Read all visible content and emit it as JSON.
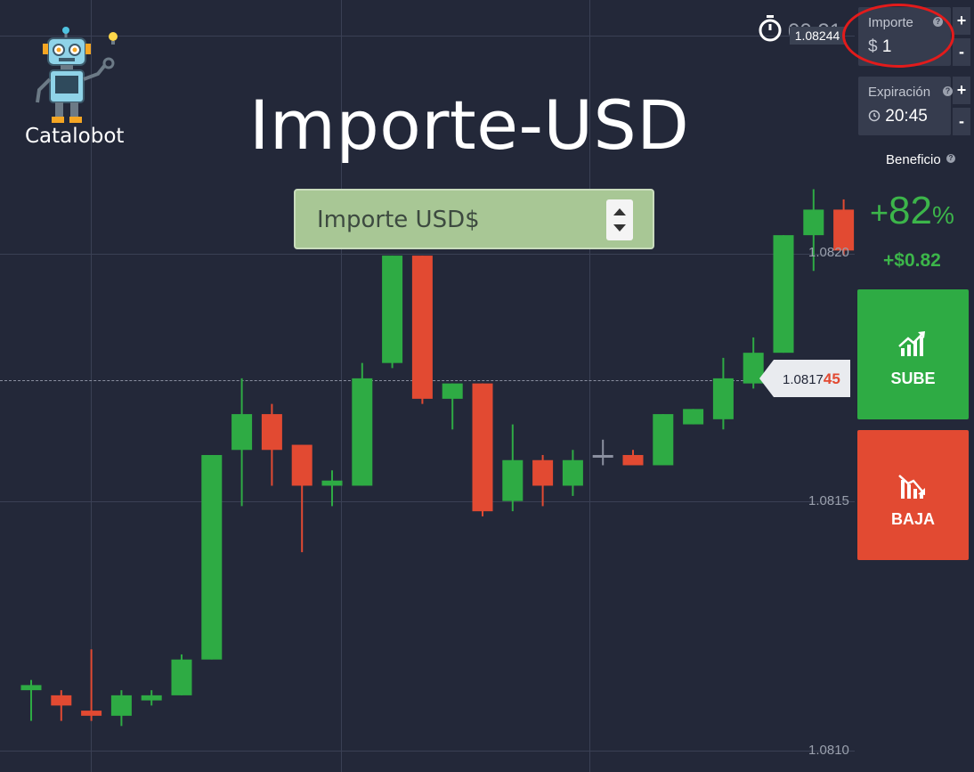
{
  "branding": {
    "logo_label": "Catalobot"
  },
  "overlay": {
    "title": "Importe-USD",
    "usd_field_label": "Importe USD$"
  },
  "header": {
    "timer": "00:21",
    "current_price": "1.08244"
  },
  "panel": {
    "importe": {
      "label": "Importe",
      "currency": "$",
      "value": "1",
      "plus": "+",
      "minus": "-"
    },
    "expiracion": {
      "label": "Expiración",
      "value": "20:45",
      "plus": "+",
      "minus": "-"
    },
    "beneficio": {
      "label": "Beneficio",
      "percent_sign": "+",
      "percent_value": "82",
      "percent_symbol": "%",
      "payout": "+$0.82"
    },
    "buttons": {
      "up": "SUBE",
      "down": "BAJA"
    }
  },
  "price_tag": {
    "main": "1.0817",
    "highlight": "45"
  },
  "y_axis": {
    "labels": [
      "1.0820",
      "1.0815",
      "1.0810"
    ]
  },
  "colors": {
    "background": "#232839",
    "up": "#2eab44",
    "down": "#e24a32",
    "profit": "#3cb54a",
    "highlight_circle": "#e31b1b"
  },
  "chart_data": {
    "type": "candlestick",
    "ylim": [
      1.08098,
      1.08249
    ],
    "y_ticks": [
      1.082,
      1.0815,
      1.081
    ],
    "current_price": 1.081745,
    "candles": [
      {
        "o": 1.08114,
        "c": 1.08115,
        "h": 1.08116,
        "l": 1.08108
      },
      {
        "o": 1.08113,
        "c": 1.08111,
        "h": 1.08114,
        "l": 1.08108
      },
      {
        "o": 1.0811,
        "c": 1.08109,
        "h": 1.08122,
        "l": 1.08108
      },
      {
        "o": 1.08109,
        "c": 1.08113,
        "h": 1.08114,
        "l": 1.08107
      },
      {
        "o": 1.08112,
        "c": 1.08113,
        "h": 1.08114,
        "l": 1.08111
      },
      {
        "o": 1.08113,
        "c": 1.0812,
        "h": 1.08121,
        "l": 1.08113
      },
      {
        "o": 1.0812,
        "c": 1.0816,
        "h": 1.0816,
        "l": 1.0812
      },
      {
        "o": 1.08161,
        "c": 1.08168,
        "h": 1.08175,
        "l": 1.0815
      },
      {
        "o": 1.08168,
        "c": 1.08161,
        "h": 1.0817,
        "l": 1.08154
      },
      {
        "o": 1.08162,
        "c": 1.08154,
        "h": 1.08162,
        "l": 1.08141
      },
      {
        "o": 1.08154,
        "c": 1.08155,
        "h": 1.08157,
        "l": 1.0815
      },
      {
        "o": 1.08154,
        "c": 1.08175,
        "h": 1.08178,
        "l": 1.08154
      },
      {
        "o": 1.08178,
        "c": 1.08199,
        "h": 1.08199,
        "l": 1.08177
      },
      {
        "o": 1.08199,
        "c": 1.08171,
        "h": 1.08199,
        "l": 1.0817
      },
      {
        "o": 1.08171,
        "c": 1.08174,
        "h": 1.08174,
        "l": 1.08165
      },
      {
        "o": 1.08174,
        "c": 1.08149,
        "h": 1.08174,
        "l": 1.08148
      },
      {
        "o": 1.08151,
        "c": 1.08159,
        "h": 1.08166,
        "l": 1.08149
      },
      {
        "o": 1.08159,
        "c": 1.08154,
        "h": 1.0816,
        "l": 1.0815
      },
      {
        "o": 1.08154,
        "c": 1.08159,
        "h": 1.08161,
        "l": 1.08152
      },
      {
        "o": 1.0816,
        "c": 1.0816,
        "h": 1.08163,
        "l": 1.08158
      },
      {
        "o": 1.0816,
        "c": 1.08158,
        "h": 1.08161,
        "l": 1.08158
      },
      {
        "o": 1.08158,
        "c": 1.08168,
        "h": 1.08168,
        "l": 1.08158
      },
      {
        "o": 1.08166,
        "c": 1.08169,
        "h": 1.08169,
        "l": 1.08166
      },
      {
        "o": 1.08167,
        "c": 1.08175,
        "h": 1.08179,
        "l": 1.08165
      },
      {
        "o": 1.08174,
        "c": 1.0818,
        "h": 1.08183,
        "l": 1.08173
      },
      {
        "o": 1.0818,
        "c": 1.08203,
        "h": 1.08203,
        "l": 1.0818
      },
      {
        "o": 1.08203,
        "c": 1.08208,
        "h": 1.08212,
        "l": 1.08196
      },
      {
        "o": 1.08208,
        "c": 1.082,
        "h": 1.0821,
        "l": 1.08199
      },
      {
        "o": 1.08199,
        "c": 1.0819,
        "h": 1.08199,
        "l": 1.08185
      }
    ]
  }
}
